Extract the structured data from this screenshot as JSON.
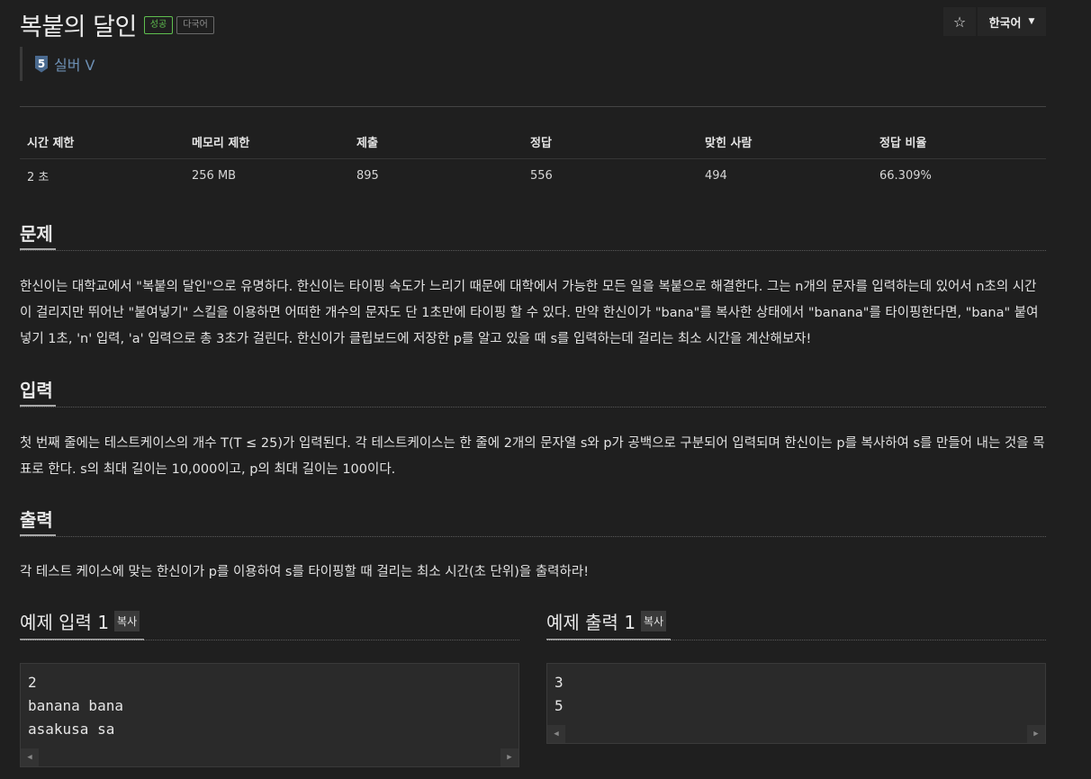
{
  "problem": {
    "title": "복붙의 달인",
    "badges": {
      "success": "성공",
      "multilang": "다국어"
    },
    "tier": {
      "number": "5",
      "label": "실버 V"
    }
  },
  "controls": {
    "star_icon": "star-icon",
    "star_glyph": "☆",
    "language": "한국어"
  },
  "stats": {
    "headers": [
      "시간 제한",
      "메모리 제한",
      "제출",
      "정답",
      "맞힌 사람",
      "정답 비율"
    ],
    "values": [
      "2 초",
      "256 MB",
      "895",
      "556",
      "494",
      "66.309%"
    ]
  },
  "sections": {
    "problem_title": "문제",
    "problem_text": "한신이는 대학교에서 \"복붙의 달인\"으로 유명하다. 한신이는 타이핑 속도가 느리기 때문에 대학에서 가능한 모든 일을 복붙으로 해결한다. 그는 n개의 문자를 입력하는데 있어서 n초의 시간이 걸리지만 뛰어난 \"붙여넣기\" 스킬을 이용하면 어떠한 개수의 문자도 단 1초만에 타이핑 할 수 있다. 만약 한신이가 \"bana\"를 복사한 상태에서 \"banana\"를 타이핑한다면, \"bana\" 붙여넣기 1초, 'n' 입력, 'a' 입력으로 총 3초가 걸린다. 한신이가 클립보드에 저장한 p를 알고 있을 때 s를 입력하는데 걸리는 최소 시간을 계산해보자!",
    "input_title": "입력",
    "input_text": "첫 번째 줄에는 테스트케이스의 개수 T(T ≤ 25)가 입력된다. 각 테스트케이스는 한 줄에 2개의 문자열 s와 p가 공백으로 구분되어 입력되며 한신이는 p를 복사하여 s를 만들어 내는 것을 목표로 한다. s의 최대 길이는 10,000이고, p의 최대 길이는 100이다.",
    "output_title": "출력",
    "output_text": "각 테스트 케이스에 맞는 한신이가 p를 이용하여 s를 타이핑할 때 걸리는 최소 시간(초 단위)을 출력하라!"
  },
  "examples": {
    "input": {
      "title": "예제 입력 1",
      "copy": "복사",
      "lines": [
        "2",
        "banana bana",
        "asakusa sa"
      ]
    },
    "output": {
      "title": "예제 출력 1",
      "copy": "복사",
      "lines": [
        "3",
        "5"
      ]
    }
  }
}
